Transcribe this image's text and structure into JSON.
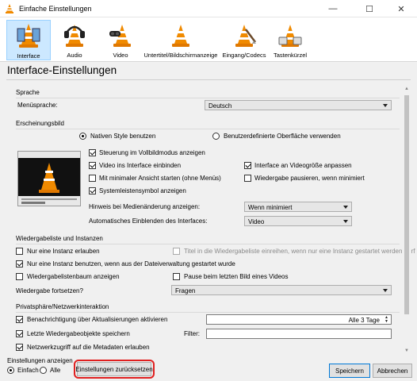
{
  "window": {
    "title": "Einfache Einstellungen",
    "minimize": "—",
    "maximize": "☐",
    "close": "✕"
  },
  "categories": [
    {
      "label": "Interface",
      "icon": "interface-icon",
      "active": true
    },
    {
      "label": "Audio",
      "icon": "audio-icon",
      "active": false
    },
    {
      "label": "Video",
      "icon": "video-icon",
      "active": false
    },
    {
      "label": "Untertitel/Bildschirmanzeige",
      "icon": "subtitle-icon",
      "active": false
    },
    {
      "label": "Eingang/Codecs",
      "icon": "codecs-icon",
      "active": false
    },
    {
      "label": "Tastenkürzel",
      "icon": "hotkeys-icon",
      "active": false
    }
  ],
  "page_title": "Interface-Einstellungen",
  "sprache": {
    "group_label": "Sprache",
    "menu_label": "Menüsprache:",
    "menu_value": "Deutsch"
  },
  "erscheinungsbild": {
    "group_label": "Erscheinungsbild",
    "radio_native": "Nativen Style benutzen",
    "radio_custom": "Benutzerdefinierte Oberfläche verwenden",
    "cb_fullscreen": "Steuerung im Vollbildmodus anzeigen",
    "cb_video_embed": "Video ins Interface einbinden",
    "cb_resize": "Interface an Videogröße anpassen",
    "cb_minimal": "Mit minimaler Ansicht starten (ohne Menüs)",
    "cb_pause_min": "Wiedergabe pausieren, wenn minimiert",
    "cb_systray": "Systemleistensymbol anzeigen",
    "hint_label": "Hinweis bei Medienänderung anzeigen:",
    "hint_value": "Wenn minimiert",
    "auto_label": "Automatisches Einblenden des Interfaces:",
    "auto_value": "Video"
  },
  "wiedergabeliste": {
    "group_label": "Wiedergabeliste und Instanzen",
    "cb_one_instance": "Nur eine Instanz erlauben",
    "cb_enqueue": "Titel in die Wiedergabeliste einreihen, wenn nur eine Instanz gestartet werden darf",
    "cb_filemanager": "Nur eine Instanz benutzen, wenn aus der Dateiverwaltung gestartet wurde",
    "cb_tree": "Wiedergabelistenbaum anzeigen",
    "cb_pause_last": "Pause beim letzten Bild eines Videos",
    "resume_label": "Wiedergabe fortsetzen?",
    "resume_value": "Fragen"
  },
  "privatsphaere": {
    "group_label": "Privatsphäre/Netzwerkinteraktion",
    "cb_updates": "Benachrichtigung über Aktualisierungen aktivieren",
    "updates_value": "Alle 3 Tage",
    "cb_recent": "Letzte Wiedergabeobjekte speichern",
    "filter_label": "Filter:",
    "cb_metadata": "Netzwerkzugriff auf die Metadaten erlauben"
  },
  "footer": {
    "show_label": "Einstellungen anzeigen",
    "radio_simple": "Einfach",
    "radio_all": "Alle",
    "reset_button": "Einstellungen zurücksetzen",
    "save_button": "Speichern",
    "cancel_button": "Abbrechen"
  },
  "colors": {
    "vlc_orange": "#f08a00",
    "selection_blue": "#cce8ff",
    "highlight_red": "#e02020"
  }
}
